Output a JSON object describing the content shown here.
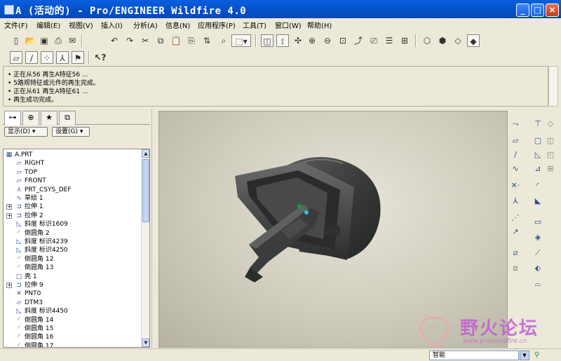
{
  "window": {
    "title": "A (活动的) - Pro/ENGINEER Wildfire 4.0",
    "minimize": "_",
    "maximize": "□",
    "close": "×"
  },
  "menu": [
    "文件(F)",
    "编辑(E)",
    "视图(V)",
    "插入(I)",
    "分析(A)",
    "信息(N)",
    "应用程序(P)",
    "工具(T)",
    "窗口(W)",
    "帮助(H)"
  ],
  "toolbar1_icons": [
    "new-icon",
    "open-icon",
    "save-icon",
    "print-icon",
    "email-icon",
    "sep",
    "undo-icon",
    "redo-icon",
    "cut-icon",
    "copy-icon",
    "paste-icon",
    "paste-special-icon",
    "regenerate-icon",
    "find-icon",
    "selection-box-icon",
    "sep",
    "repaint-icon",
    "spin-center-icon",
    "orient-icon",
    "zoom-in-icon",
    "zoom-out-icon",
    "refit-icon",
    "reorient-icon",
    "saved-views-icon",
    "layers-icon",
    "view-manager-icon",
    "sep",
    "wireframe-icon",
    "hidden-line-icon",
    "no-hidden-icon",
    "shading-icon"
  ],
  "toolbar2_icons": [
    "datum-plane-display-icon",
    "datum-axis-display-icon",
    "point-display-icon",
    "csys-display-icon",
    "annotation-display-icon",
    "sep",
    "context-help-icon"
  ],
  "messages": [
    "• 正在从56 再生A特征56 ...",
    "• 5路观特征或元件的再生完成。",
    "• 正在从61 再生A特征61 ...",
    "• 再生成功完成。"
  ],
  "panel": {
    "tabs": [
      "tree-tab",
      "folder-tab",
      "favorites-tab",
      "layer-tab"
    ],
    "show_label": "显示(D) ▾",
    "settings_label": "设置(G) ▾"
  },
  "tree": [
    {
      "label": "A.PRT",
      "icon": "part",
      "level": 0,
      "expand": ""
    },
    {
      "label": "RIGHT",
      "icon": "plane",
      "level": 1,
      "expand": ""
    },
    {
      "label": "TOP",
      "icon": "plane",
      "level": 1,
      "expand": ""
    },
    {
      "label": "FRONT",
      "icon": "plane",
      "level": 1,
      "expand": ""
    },
    {
      "label": "PRT_CSYS_DEF",
      "icon": "csys",
      "level": 1,
      "expand": ""
    },
    {
      "label": "草绘 1",
      "icon": "sketch",
      "level": 1,
      "expand": ""
    },
    {
      "label": "拉伸 1",
      "icon": "extrude",
      "level": 1,
      "expand": "+"
    },
    {
      "label": "拉伸 2",
      "icon": "extrude",
      "level": 1,
      "expand": "+"
    },
    {
      "label": "斜度 标识1609",
      "icon": "draft",
      "level": 1,
      "expand": ""
    },
    {
      "label": "倒圆角 2",
      "icon": "round",
      "level": 1,
      "expand": ""
    },
    {
      "label": "斜度 标识4239",
      "icon": "draft",
      "level": 1,
      "expand": ""
    },
    {
      "label": "斜度 标识4250",
      "icon": "draft",
      "level": 1,
      "expand": ""
    },
    {
      "label": "倒圆角 12",
      "icon": "round",
      "level": 1,
      "expand": ""
    },
    {
      "label": "倒圆角 13",
      "icon": "round",
      "level": 1,
      "expand": ""
    },
    {
      "label": "壳 1",
      "icon": "shell",
      "level": 1,
      "expand": ""
    },
    {
      "label": "拉伸 9",
      "icon": "extrude",
      "level": 1,
      "expand": "+"
    },
    {
      "label": "PNT0",
      "icon": "point",
      "level": 1,
      "expand": ""
    },
    {
      "label": "DTM3",
      "icon": "plane",
      "level": 1,
      "expand": ""
    },
    {
      "label": "斜度 标识4450",
      "icon": "draft",
      "level": 1,
      "expand": ""
    },
    {
      "label": "倒圆角 14",
      "icon": "round",
      "level": 1,
      "expand": ""
    },
    {
      "label": "倒圆角 15",
      "icon": "round",
      "level": 1,
      "expand": ""
    },
    {
      "label": "倒圆角 16",
      "icon": "round",
      "level": 1,
      "expand": ""
    },
    {
      "label": "倒圆角 17",
      "icon": "round",
      "level": 1,
      "expand": ""
    }
  ],
  "right_toolbar_icons": [
    [
      "sketch-tool-icon",
      "hole-icon"
    ],
    [
      "datum-plane-icon",
      "shell-icon"
    ],
    [
      "datum-axis-icon",
      "rib-icon"
    ],
    [
      "datum-curve-icon",
      "draft-icon"
    ],
    [
      "datum-point-icon",
      "round-icon"
    ],
    [
      "csys-icon",
      "chamfer-icon"
    ],
    [
      "analysis-icon",
      "extrude-tool-icon"
    ],
    [
      "insert-mode-icon",
      "revolve-icon"
    ],
    [
      "mirror-icon",
      "variable-sweep-icon"
    ],
    [
      "merge-icon",
      "blend-icon"
    ],
    [
      "trim-icon",
      "boundary-blend-icon"
    ],
    [
      "pattern-icon",
      "style-icon"
    ]
  ],
  "status": {
    "filter_value": "智能",
    "filter_arrow": "▼"
  },
  "watermark": {
    "text": "野火论坛",
    "url": "www.proewildfire.cn"
  },
  "colors": {
    "titlebar": "#0451c8",
    "model": "#3a3c3c",
    "background": "#cfccbd"
  }
}
